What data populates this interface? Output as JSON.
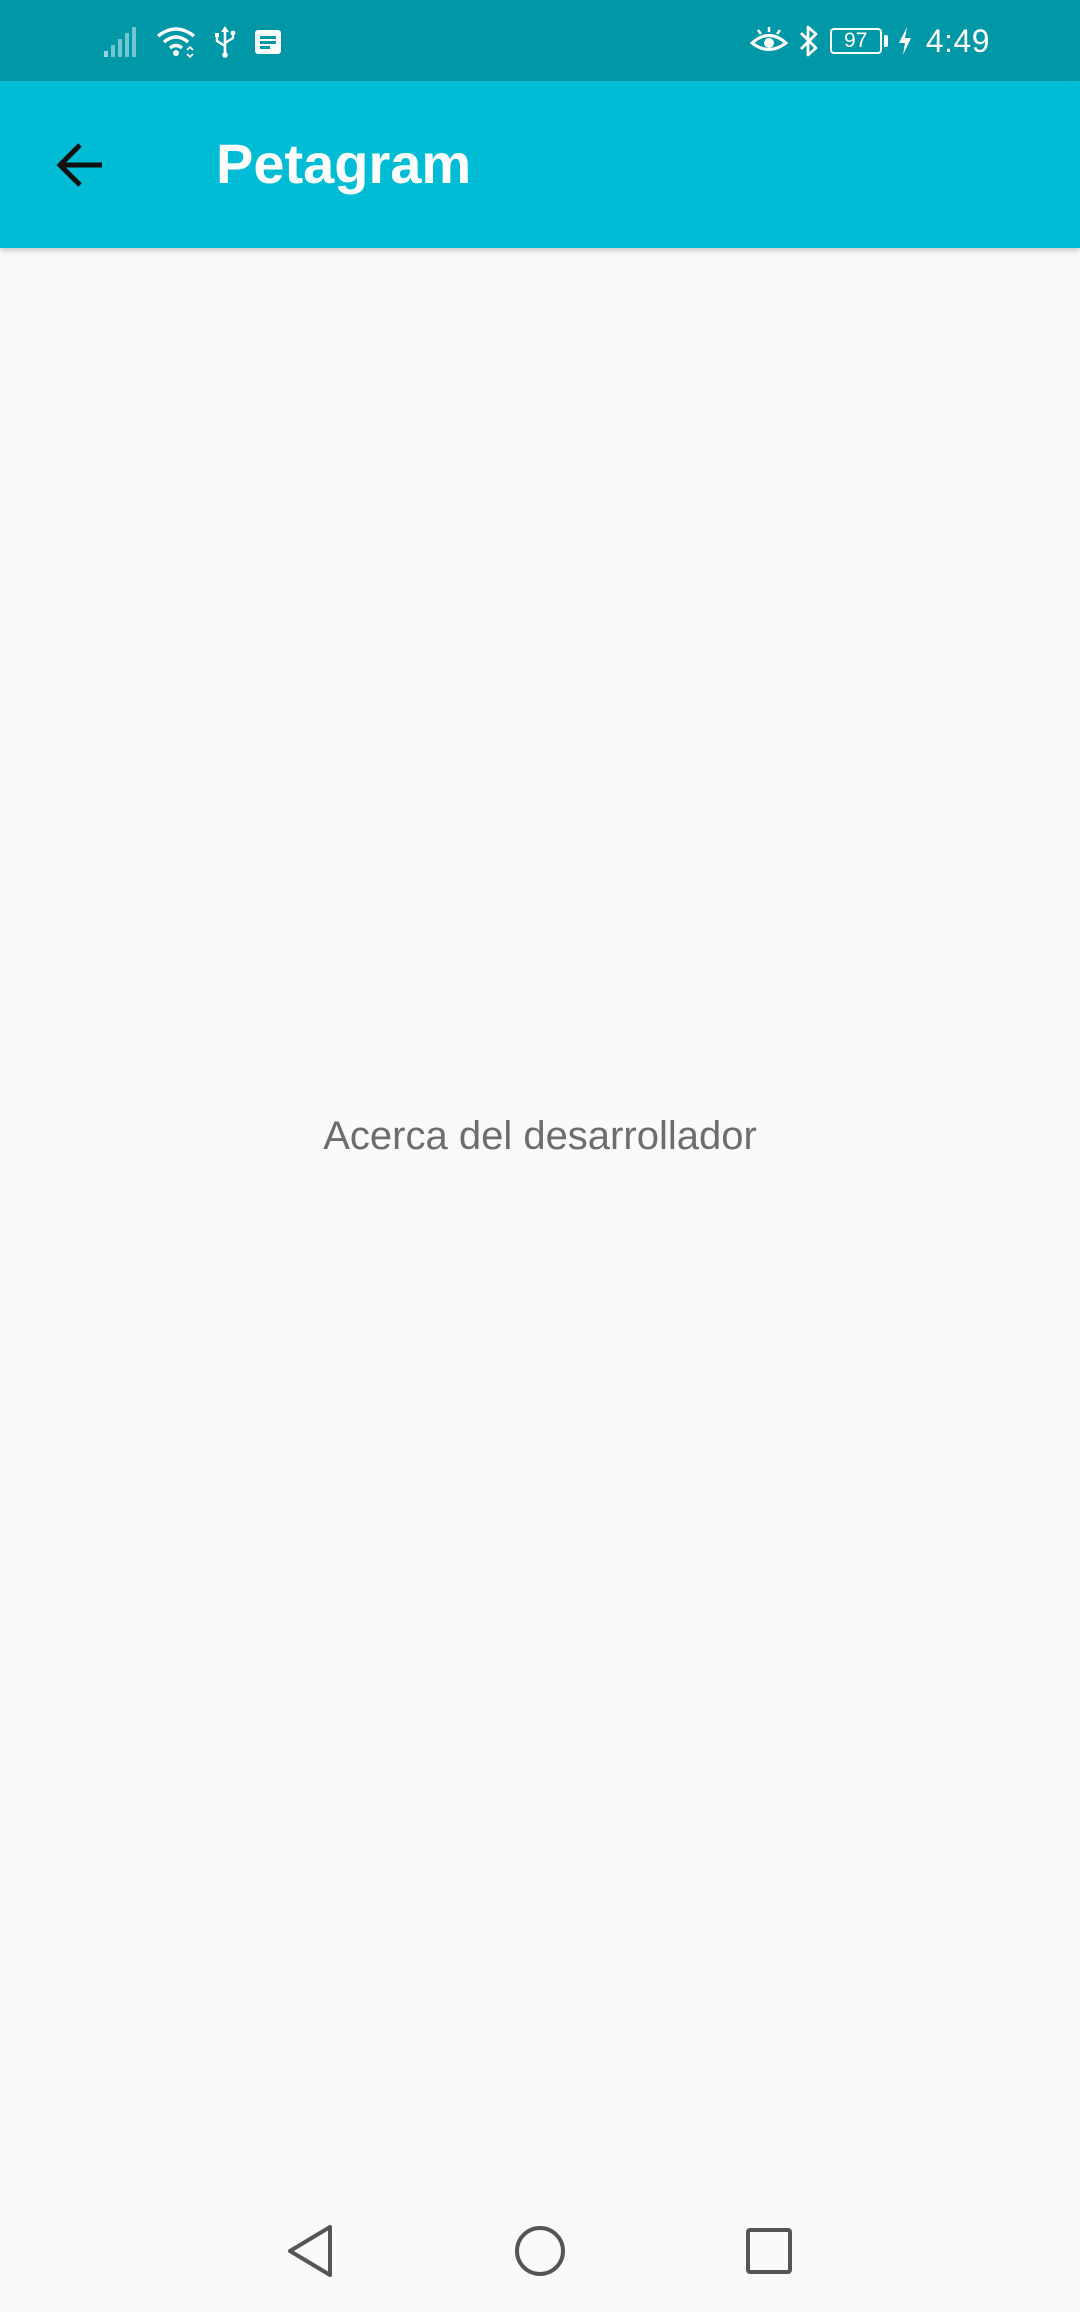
{
  "status_bar": {
    "battery_level": "97",
    "time": "4:49",
    "icons": [
      "signal-icon",
      "wifi-icon",
      "usb-icon",
      "notification-icon",
      "eye-comfort-icon",
      "bluetooth-icon",
      "battery-icon",
      "charging-icon"
    ]
  },
  "toolbar": {
    "title": "Petagram",
    "back_icon": "arrow-back-icon"
  },
  "content": {
    "text": "Acerca del desarrollador"
  },
  "nav_bar": {
    "buttons": [
      "back-triangle-icon",
      "home-circle-icon",
      "recents-square-icon"
    ]
  },
  "colors": {
    "status_bar": "#0097a7",
    "toolbar": "#00bcd4",
    "background": "#fafafa",
    "content_text": "#6d6d6d"
  }
}
